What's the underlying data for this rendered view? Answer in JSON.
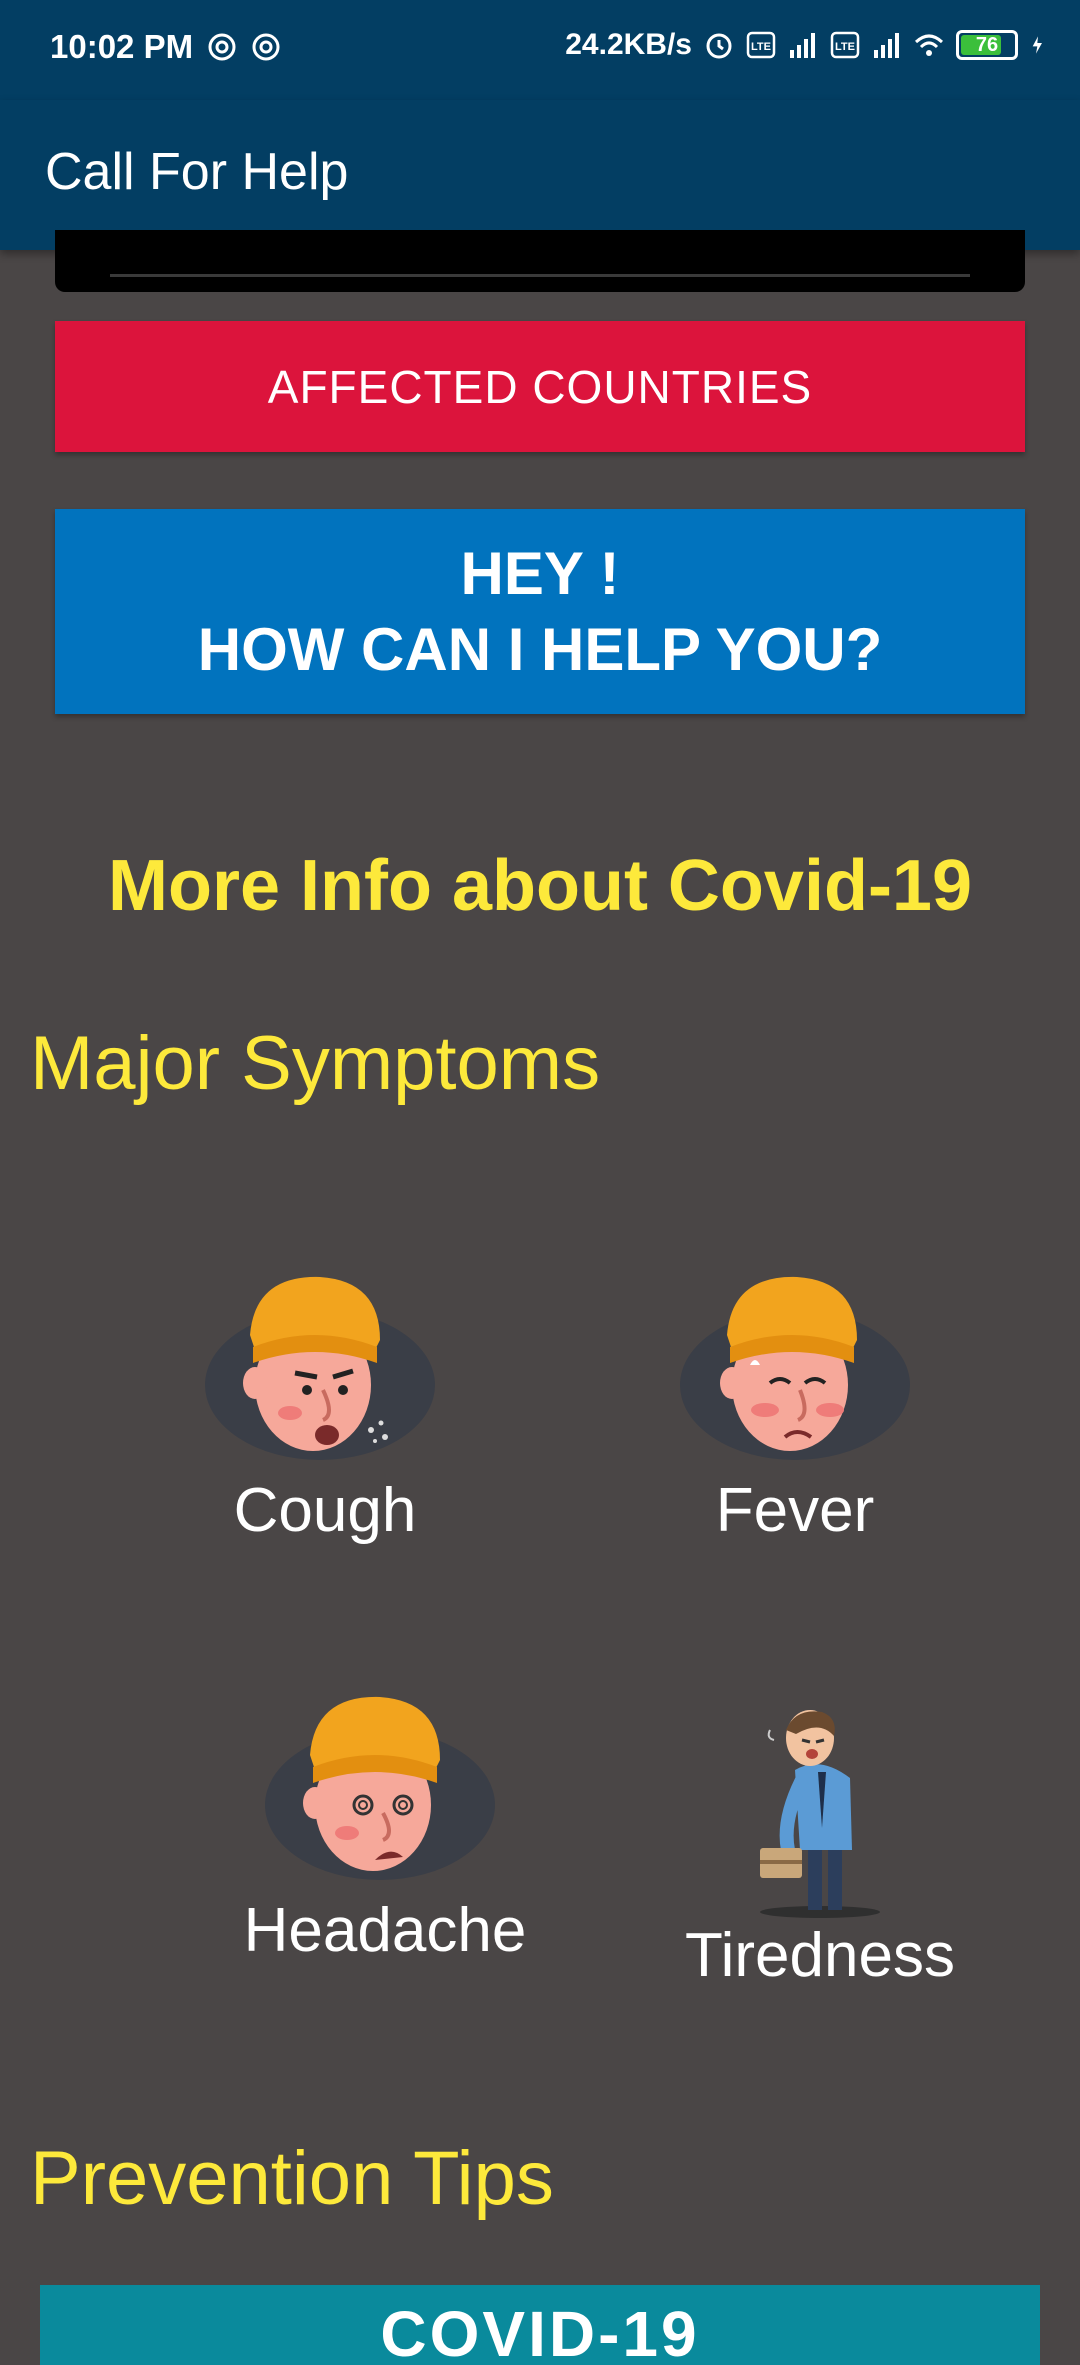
{
  "status_bar": {
    "time": "10:02 PM",
    "net_speed": "24.2KB/s",
    "battery": "76",
    "battery_level": 0.76,
    "icons": [
      "at-icon",
      "at-icon",
      "alarm-icon",
      "volte-icon",
      "signal-icon",
      "volte-icon",
      "signal-icon",
      "wifi-icon",
      "battery-icon",
      "charging-icon"
    ]
  },
  "app_bar": {
    "title": "Call For Help"
  },
  "buttons": {
    "affected_countries": "AFFECTED COUNTRIES",
    "help_line1": "HEY !",
    "help_line2": "HOW CAN I HELP YOU?"
  },
  "more_info": "More Info about Covid-19",
  "major_symptoms": {
    "title": "Major Symptoms",
    "items": [
      {
        "label": "Cough",
        "icon": "coughing-face-illustration"
      },
      {
        "label": "Fever",
        "icon": "feverish-face-illustration"
      },
      {
        "label": "Headache",
        "icon": "dizzy-face-illustration"
      },
      {
        "label": "Tiredness",
        "icon": "tired-man-illustration"
      }
    ]
  },
  "prevention": {
    "title": "Prevention Tips",
    "card_text": "COVID-19"
  },
  "colors": {
    "bar": "#033e63",
    "background": "#4a4646",
    "accent_yellow": "#fde93b",
    "red_button": "#dc143c",
    "blue_button": "#0173be",
    "teal_card": "#0a8a9c"
  }
}
